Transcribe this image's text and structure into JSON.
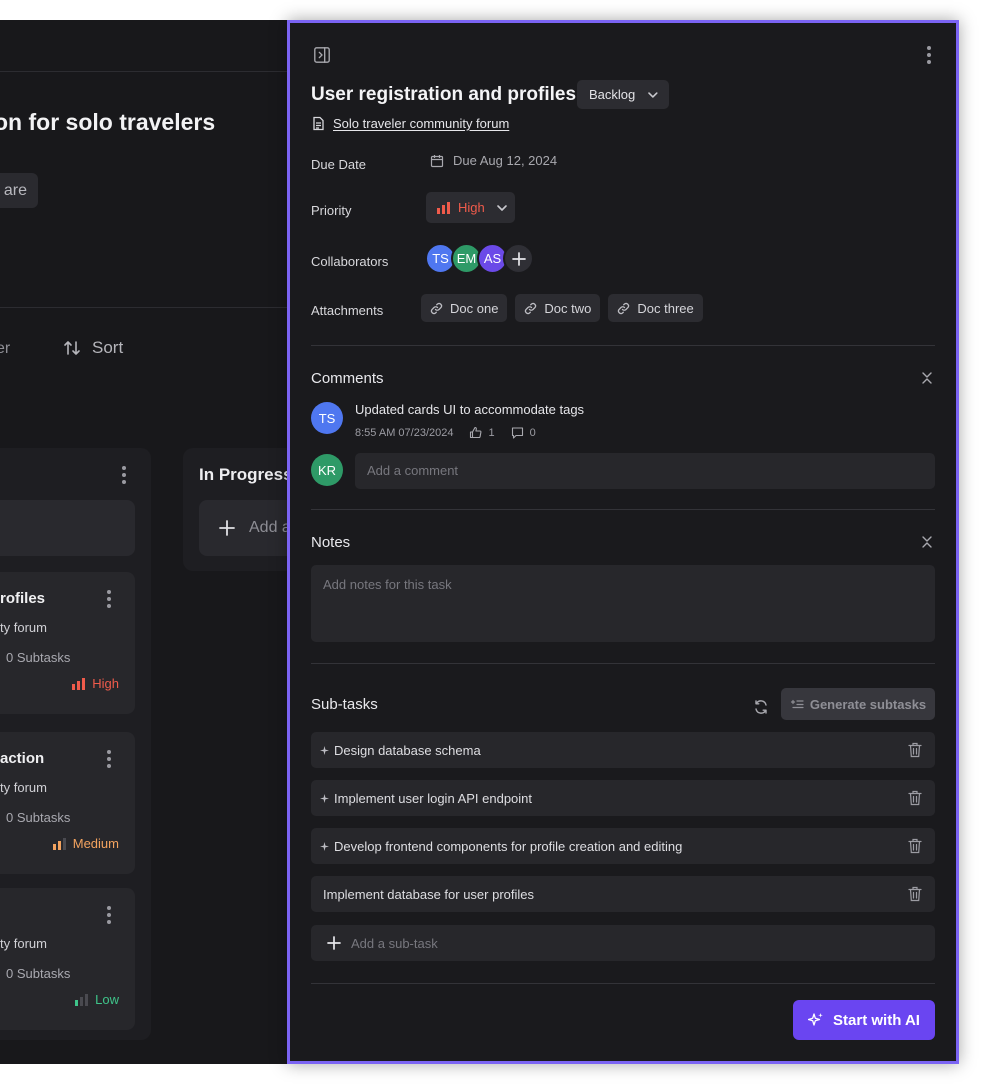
{
  "board": {
    "project_title": "on for solo travelers",
    "share_label": "are",
    "filter_label": "er",
    "sort_label": "Sort",
    "columns": [
      {
        "title": ""
      },
      {
        "title": "In Progress",
        "add_label": "Add a"
      }
    ],
    "cards": [
      {
        "title": "rofiles",
        "subtitle": "ty forum",
        "subtasks": "0 Subtasks",
        "priority": "High"
      },
      {
        "title": "action",
        "subtitle": "ty forum",
        "subtasks": "0 Subtasks",
        "priority": "Medium"
      },
      {
        "title": "",
        "subtitle": "ty forum",
        "subtasks": "0 Subtasks",
        "priority": "Low"
      }
    ]
  },
  "panel": {
    "title": "User registration and profiles",
    "status": "Backlog",
    "project_link": "Solo traveler community forum",
    "fields": {
      "due_label": "Due Date",
      "due_value": "Due Aug 12, 2024",
      "priority_label": "Priority",
      "priority_value": "High",
      "collaborators_label": "Collaborators",
      "attachments_label": "Attachments"
    },
    "collaborators": [
      {
        "initials": "TS",
        "color": "#4f77f0"
      },
      {
        "initials": "EM",
        "color": "#2e9a67"
      },
      {
        "initials": "AS",
        "color": "#6b4ae8"
      }
    ],
    "attachments": [
      "Doc one",
      "Doc two",
      "Doc three"
    ],
    "comments_section": {
      "title": "Comments",
      "items": [
        {
          "initials": "TS",
          "avatar_color": "#4f77f0",
          "text": "Updated cards UI to accommodate tags",
          "time": "8:55 AM 07/23/2024",
          "likes": "1",
          "replies": "0"
        }
      ],
      "current_user_initials": "KR",
      "current_user_color": "#2e9a67",
      "placeholder": "Add a comment"
    },
    "notes_section": {
      "title": "Notes",
      "placeholder": "Add notes for this task"
    },
    "subtasks_section": {
      "title": "Sub-tasks",
      "generate_label": "Generate subtasks",
      "items": [
        {
          "label": "Design database schema",
          "ai": true
        },
        {
          "label": "Implement user login API endpoint",
          "ai": true
        },
        {
          "label": "Develop frontend components for profile creation and editing",
          "ai": true
        },
        {
          "label": "Implement database for user profiles",
          "ai": false
        }
      ],
      "add_label": "Add a sub-task"
    },
    "start_ai_label": "Start with AI"
  },
  "colors": {
    "accent": "#6a45f1",
    "panel_border": "#7b64f3",
    "priority_high": "#ef5b4b",
    "priority_medium": "#f3a35f",
    "priority_low": "#3fc48a"
  }
}
